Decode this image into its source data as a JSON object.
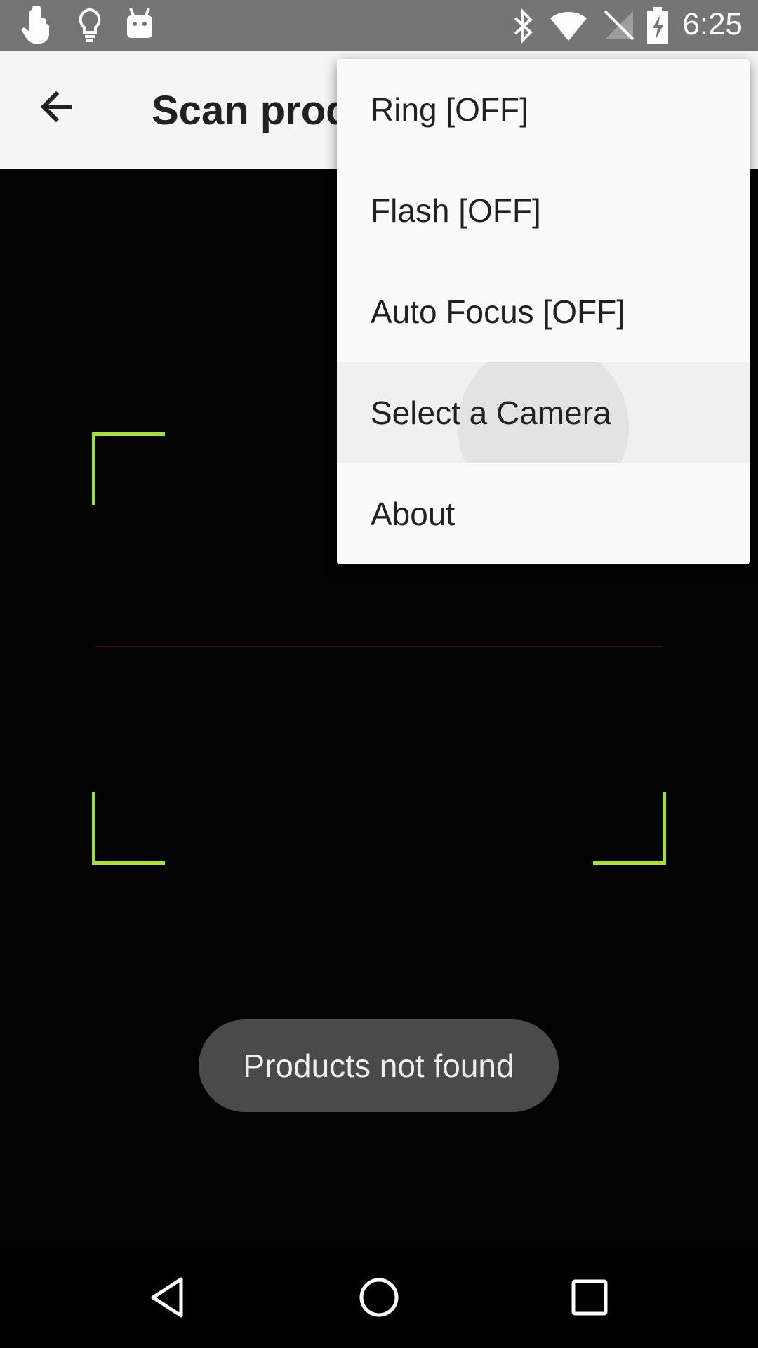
{
  "status_bar": {
    "time": "6:25",
    "left_icons": [
      "touch-icon",
      "lightbulb-icon",
      "android-icon"
    ],
    "right_icons": [
      "bluetooth-icon",
      "wifi-icon",
      "no-signal-icon",
      "battery-charging-icon"
    ]
  },
  "app_bar": {
    "title": "Scan products",
    "back_icon": "arrow-back-icon"
  },
  "menu": {
    "items": [
      {
        "label": "Ring [OFF]"
      },
      {
        "label": "Flash [OFF]"
      },
      {
        "label": "Auto Focus [OFF]"
      },
      {
        "label": "Select a Camera"
      },
      {
        "label": "About"
      }
    ]
  },
  "toast": {
    "text": "Products not found"
  },
  "colors": {
    "viewfinder_corner": "#a6e22e",
    "status_bar": "#757575",
    "app_bar": "#f5f5f5"
  },
  "nav_bar": {
    "icons": [
      "back-triangle-icon",
      "home-circle-icon",
      "recents-square-icon"
    ]
  }
}
